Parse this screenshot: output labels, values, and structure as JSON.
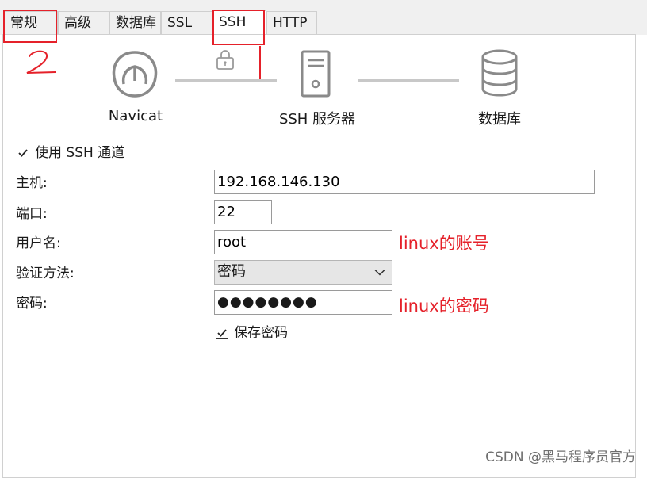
{
  "tabs": [
    {
      "label": "常规"
    },
    {
      "label": "高级"
    },
    {
      "label": "数据库"
    },
    {
      "label": "SSL"
    },
    {
      "label": "SSH"
    },
    {
      "label": "HTTP"
    }
  ],
  "annotations": {
    "step_2": "2",
    "step_1": "1",
    "account_note": "linux的账号",
    "password_note": "linux的密码"
  },
  "diagram": {
    "navicat_label": "Navicat",
    "ssh_server_label": "SSH 服务器",
    "database_label": "数据库"
  },
  "form": {
    "use_ssh_tunnel": {
      "label": "使用 SSH 通道",
      "checked": true
    },
    "host": {
      "label": "主机:",
      "value": "192.168.146.130"
    },
    "port": {
      "label": "端口:",
      "value": "22"
    },
    "username": {
      "label": "用户名:",
      "value": "root"
    },
    "auth_method": {
      "label": "验证方法:",
      "value": "密码"
    },
    "password": {
      "label": "密码:",
      "value": "●●●●●●●●"
    },
    "save_password": {
      "label": "保存密码",
      "checked": true
    }
  },
  "watermark": "CSDN @黑马程序员官方",
  "colors": {
    "annotation_red": "#e5212a",
    "icon_gray": "#8a8a8a"
  }
}
